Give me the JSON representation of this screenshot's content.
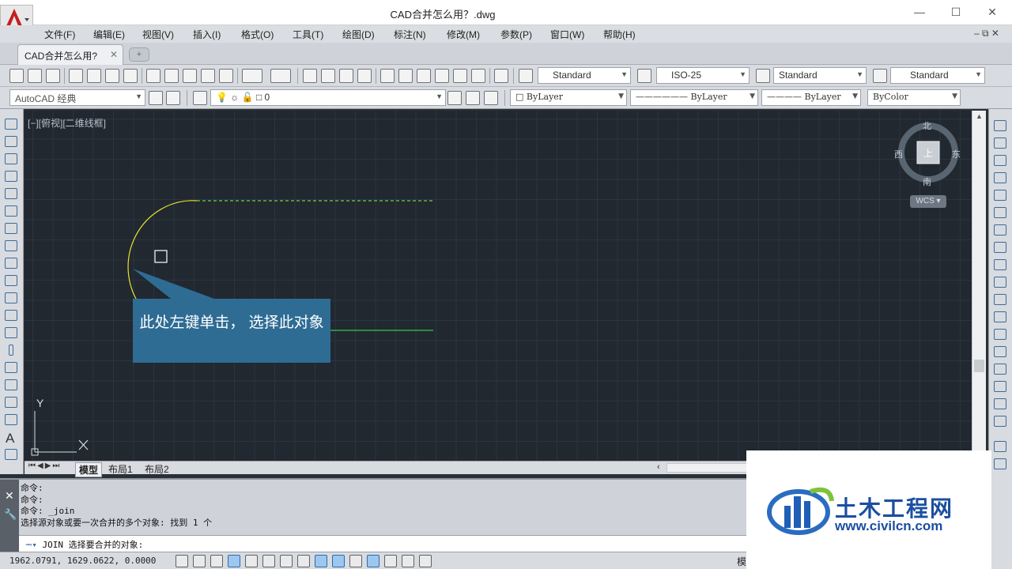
{
  "window": {
    "title": "CAD合并怎么用？.dwg",
    "minimize_glyph": "—",
    "maximize_glyph": "☐",
    "close_glyph": "✕"
  },
  "menu": {
    "items": [
      "文件(F)",
      "编辑(E)",
      "视图(V)",
      "插入(I)",
      "格式(O)",
      "工具(T)",
      "绘图(D)",
      "标注(N)",
      "修改(M)",
      "参数(P)",
      "窗口(W)",
      "帮助(H)"
    ],
    "mdi_controls": "– ⧉ ✕"
  },
  "document_tab": {
    "label": "CAD合并怎么用?",
    "close_glyph": "✕",
    "new_tab_glyph": "+"
  },
  "toolbar_styles": {
    "text_style": "Standard",
    "dim_style": "ISO-25",
    "table_style": "Standard",
    "multileader_style": "Standard"
  },
  "toolbar_properties": {
    "workspace": "AutoCAD 经典",
    "layer": "0",
    "color": "ByLayer",
    "linetype": "ByLayer",
    "lineweight": "ByLayer",
    "plot_style": "ByColor"
  },
  "viewport": {
    "label": "[−][俯视][二维线框]",
    "ucs_y": "Y",
    "ucs_x": "X"
  },
  "viewcube": {
    "north": "北",
    "south": "南",
    "west": "西",
    "east": "东",
    "face": "上",
    "wcs": "WCS"
  },
  "callout": {
    "text": "此处左键单击， 选择此对象"
  },
  "layout_tabs": {
    "model": "模型",
    "layout1": "布局1",
    "layout2": "布局2"
  },
  "command_line": {
    "history": [
      "命令:",
      "命令:",
      "命令: _join",
      "选择源对象或要一次合并的多个对象: 找到 1 个"
    ],
    "prompt": "JOIN 选择要合并的对象:"
  },
  "status": {
    "coordinates": "1962.0791, 1629.0622, 0.0000",
    "model_label": "模"
  },
  "watermark": {
    "title": "土木工程网",
    "url": "www.civilcn.com"
  },
  "colors": {
    "canvas_bg": "#212830",
    "arc": "#e6e22a",
    "dashed_line": "#6bd24a",
    "solid_line": "#38c44a",
    "callout_bg": "#2e6c94",
    "logo_red": "#c41e1e"
  }
}
